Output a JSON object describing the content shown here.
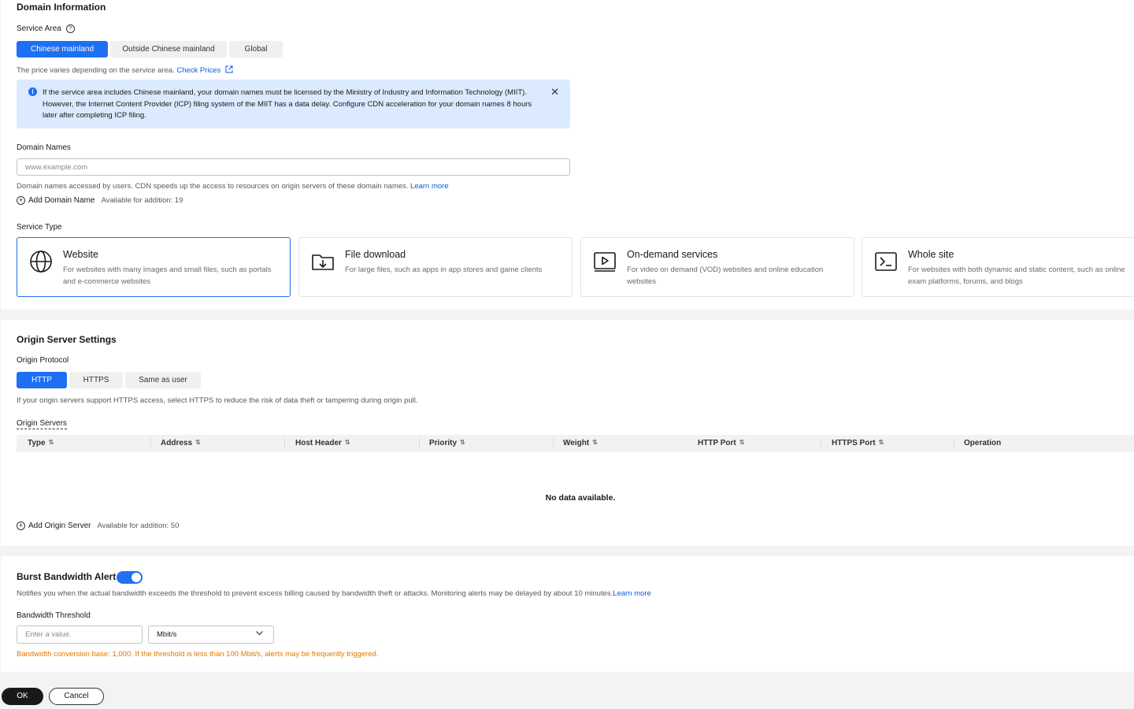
{
  "domain_info": {
    "title": "Domain Information",
    "service_area_label": "Service Area",
    "service_area_options": [
      "Chinese mainland",
      "Outside Chinese mainland",
      "Global"
    ],
    "service_area_selected": "Chinese mainland",
    "price_hint": "The price varies depending on the service area.",
    "check_prices": "Check Prices",
    "notice_line1": "If the service area includes Chinese mainland, your domain names must be licensed by the Ministry of Industry and Information Technology (MIIT).",
    "notice_line2": "However, the Internet Content Provider (ICP) filing system of the MIIT has a data delay. Configure CDN acceleration for your domain names 8 hours later after completing ICP filing.",
    "domain_names_label": "Domain Names",
    "domain_placeholder": "www.example.com",
    "domain_hint": "Domain names accessed by users. CDN speeds up the access to resources on origin servers of these domain names.",
    "learn_more": "Learn more",
    "add_domain": "Add Domain Name",
    "add_domain_count": "Available for addition: 19",
    "service_type_label": "Service Type",
    "service_types": [
      {
        "title": "Website",
        "desc": "For websites with many images and small files, such as portals and e-commerce websites",
        "icon": "globe-icon"
      },
      {
        "title": "File download",
        "desc": "For large files, such as apps in app stores and game clients",
        "icon": "folder-download-icon"
      },
      {
        "title": "On-demand services",
        "desc": "For video on demand (VOD) websites and online education websites",
        "icon": "video-play-icon"
      },
      {
        "title": "Whole site",
        "desc": "For websites with both dynamic and static content, such as online exam platforms, forums, and blogs",
        "icon": "terminal-icon"
      }
    ],
    "service_type_selected": "Website"
  },
  "origin": {
    "title": "Origin Server Settings",
    "protocol_label": "Origin Protocol",
    "protocol_options": [
      "HTTP",
      "HTTPS",
      "Same as user"
    ],
    "protocol_selected": "HTTP",
    "protocol_hint": "If your origin servers support HTTPS access, select HTTPS to reduce the risk of data theft or tampering during origin pull.",
    "servers_label": "Origin Servers",
    "columns": [
      "Type",
      "Address",
      "Host Header",
      "Priority",
      "Weight",
      "HTTP Port",
      "HTTPS Port",
      "Operation"
    ],
    "empty_text": "No data available.",
    "add_server": "Add Origin Server",
    "add_server_count": "Available for addition: 50"
  },
  "burst": {
    "title": "Burst Bandwidth Alert",
    "enabled": true,
    "desc": "Notifies you when the actual bandwidth exceeds the threshold to prevent excess billing caused by bandwidth theft or attacks. Monitoring alerts may be delayed by about 10 minutes.",
    "learn_more": "Learn more",
    "threshold_label": "Bandwidth Threshold",
    "threshold_placeholder": "Enter a value.",
    "unit_selected": "Mbit/s",
    "warning": "Bandwidth conversion base: 1,000. If the threshold is less than 100 Mbit/s, alerts may be frequently triggered."
  },
  "footer": {
    "ok_label": "OK",
    "cancel_label": "Cancel"
  },
  "colors": {
    "accent": "#1f6ff2",
    "info_bg": "#dbeafe",
    "warning": "#e07800"
  }
}
